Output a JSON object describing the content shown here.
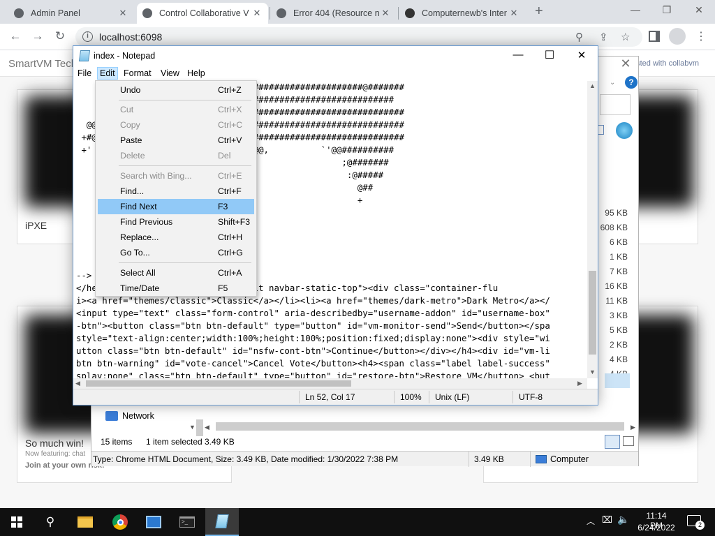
{
  "browser": {
    "tabs": [
      {
        "title": "Admin Panel",
        "favicon_color": "#5f6368"
      },
      {
        "title": "Control Collaborative V",
        "favicon_color": "#5f6368"
      },
      {
        "title": "Error 404 (Resource no",
        "favicon_color": "#5f6368"
      },
      {
        "title": "Computernewb's Inter",
        "favicon_color": "#333333"
      }
    ],
    "new_tab": "+",
    "url": "localhost:6098"
  },
  "site": {
    "brand": "SmartVM Tech",
    "header_right": "osted with collabvm",
    "cards": [
      {
        "label": "iPXE"
      },
      {
        "label": "So much win!",
        "sub1": "Now featuring: chat",
        "sub2": "Join at your own risk!"
      }
    ]
  },
  "explorer": {
    "sizes": [
      "95 KB",
      "608 KB",
      "6 KB",
      "1 KB",
      "7 KB",
      "16 KB",
      "11 KB",
      "3 KB",
      "5 KB",
      "2 KB",
      "4 KB",
      "4 KB"
    ],
    "nav_network": "Network",
    "items_count": "15 items",
    "selected": "1 item selected",
    "selected_size": "3.49 KB",
    "status_type": "Type: Chrome HTML Document, Size: 3.49 KB, Date modified: 1/30/2022 7:38 PM",
    "status_size": "3.49 KB",
    "status_location": "Computer"
  },
  "notepad": {
    "title": "index - Notepad",
    "menu": [
      "File",
      "Edit",
      "Format",
      "View",
      "Help"
    ],
    "art_lines": [
      "                   ########@ ''''######################@#######",
      "                   ########@ '###############################",
      "                   #######:  ##################################",
      "  @@               #######' `@ ################################",
      " +#@               #######+ .@#@ ##############################",
      " +'                :####@ ########@@,          `'@@##########",
      "                   #####@ #####@:                  ;@#######",
      "                   #####@ ####                      :@#####",
      "                   ####@@ #'                          @##",
      "                   ####@                              +",
      "                   ##@.",
      "                   @,"
    ],
    "code_lines": [
      "-->",
      "</he                ' navbar-default navbar-static-top\"><div class=\"container-flu",
      "i><a href=\"themes/classic\">Classic</a></li><li><a href=\"themes/dark-metro\">Dark Metro</a></",
      "<input type=\"text\" class=\"form-control\" aria-describedby=\"username-addon\" id=\"username-box\"",
      "-btn\"><button class=\"btn btn-default\" type=\"button\" id=\"vm-monitor-send\">Send</button></spa",
      "style=\"text-align:center;width:100%;height:100%;position:fixed;display:none\"><div style=\"wi",
      "utton class=\"btn btn-default\" id=\"nsfw-cont-btn\">Continue</button></div></h4><div id=\"vm-li",
      "btn btn-warning\" id=\"vote-cancel\">Cancel Vote</button><h4><span class=\"label label-success\"",
      "splay:none\" class=\"btn btn-default\" type=\"button\" id=\"restore-btn\">Restore VM</button> <but"
    ],
    "status": {
      "position": "Ln 52, Col 17",
      "zoom": "100%",
      "eol": "Unix (LF)",
      "encoding": "UTF-8"
    }
  },
  "edit_menu": {
    "items": [
      {
        "label": "Undo",
        "shortcut": "Ctrl+Z",
        "disabled": false
      },
      {
        "label": "Cut",
        "shortcut": "Ctrl+X",
        "disabled": true
      },
      {
        "label": "Copy",
        "shortcut": "Ctrl+C",
        "disabled": true
      },
      {
        "label": "Paste",
        "shortcut": "Ctrl+V",
        "disabled": false
      },
      {
        "label": "Delete",
        "shortcut": "Del",
        "disabled": true
      },
      {
        "label": "Search with Bing...",
        "shortcut": "Ctrl+E",
        "disabled": true
      },
      {
        "label": "Find...",
        "shortcut": "Ctrl+F",
        "disabled": false
      },
      {
        "label": "Find Next",
        "shortcut": "F3",
        "disabled": false,
        "highlighted": true
      },
      {
        "label": "Find Previous",
        "shortcut": "Shift+F3",
        "disabled": false
      },
      {
        "label": "Replace...",
        "shortcut": "Ctrl+H",
        "disabled": false
      },
      {
        "label": "Go To...",
        "shortcut": "Ctrl+G",
        "disabled": false
      },
      {
        "label": "Select All",
        "shortcut": "Ctrl+A",
        "disabled": false
      },
      {
        "label": "Time/Date",
        "shortcut": "F5",
        "disabled": false
      }
    ]
  },
  "taskbar": {
    "time": "11:14 PM",
    "date": "6/24/2022",
    "notifications": "2"
  }
}
